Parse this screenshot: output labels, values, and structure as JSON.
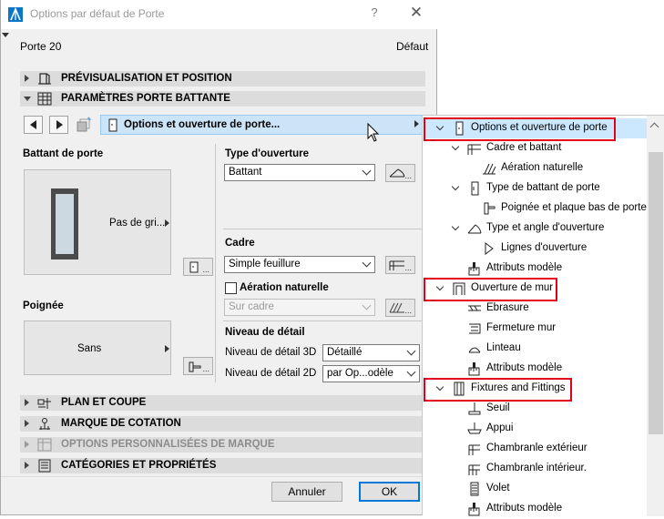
{
  "window": {
    "title": "Options par défaut de Porte",
    "help": "?",
    "close": "✕"
  },
  "header": {
    "door_name": "Porte 20",
    "default_label": "Défaut"
  },
  "sections_top": [
    {
      "label": "PRÉVISUALISATION ET POSITION",
      "expanded": false
    },
    {
      "label": "PARAMÈTRES PORTE BATTANTE",
      "expanded": true
    }
  ],
  "nav": {
    "page_label": "Options et ouverture de porte..."
  },
  "left_panel": {
    "leaf_title": "Battant de porte",
    "leaf_value": "Pas de gri...",
    "handle_title": "Poignée",
    "handle_value": "Sans"
  },
  "right_panel": {
    "opening_title": "Type d'ouverture",
    "opening_value": "Battant",
    "frame_title": "Cadre",
    "frame_value": "Simple feuillure",
    "ventilation_label": "Aération naturelle",
    "ventilation_checked": false,
    "ventilation_value": "Sur cadre",
    "detail_title": "Niveau de détail",
    "detail_3d_label": "Niveau de détail 3D",
    "detail_3d_value": "Détaillé",
    "detail_2d_label": "Niveau de détail 2D",
    "detail_2d_value": "par Op...odèle",
    "more": "..."
  },
  "sections_bottom": [
    {
      "label": "PLAN ET COUPE",
      "disabled": false
    },
    {
      "label": "MARQUE DE COTATION",
      "disabled": false
    },
    {
      "label": "OPTIONS PERSONNALISÉES DE MARQUE",
      "disabled": true
    },
    {
      "label": "CATÉGORIES ET PROPRIÉTÉS",
      "disabled": false
    }
  ],
  "footer": {
    "cancel": "Annuler",
    "ok": "OK"
  },
  "tree": [
    {
      "label": "Options et ouverture de porte",
      "level": 0,
      "expander": true,
      "selected": true,
      "highlight": true
    },
    {
      "label": "Cadre et battant",
      "level": 1,
      "expander": true
    },
    {
      "label": "Aération naturelle",
      "level": 2,
      "expander": false
    },
    {
      "label": "Type de battant de porte",
      "level": 1,
      "expander": true
    },
    {
      "label": "Poignée et plaque bas de porte",
      "level": 2,
      "expander": false
    },
    {
      "label": "Type et angle d'ouverture",
      "level": 1,
      "expander": true
    },
    {
      "label": "Lignes d'ouverture",
      "level": 2,
      "expander": false
    },
    {
      "label": "Attributs modèle",
      "level": 1,
      "expander": false
    },
    {
      "label": "Ouverture de mur",
      "level": 0,
      "expander": true,
      "highlight": true
    },
    {
      "label": "Ebrasure",
      "level": 1,
      "expander": false
    },
    {
      "label": "Fermeture mur",
      "level": 1,
      "expander": false
    },
    {
      "label": "Linteau",
      "level": 1,
      "expander": false
    },
    {
      "label": "Attributs modèle",
      "level": 1,
      "expander": false
    },
    {
      "label": "Fixtures and Fittings",
      "level": 0,
      "expander": true,
      "highlight": true
    },
    {
      "label": "Seuil",
      "level": 1,
      "expander": false
    },
    {
      "label": "Appui",
      "level": 1,
      "expander": false
    },
    {
      "label": "Chambranle extérieur",
      "level": 1,
      "expander": false
    },
    {
      "label": "Chambranle intérieur.",
      "level": 1,
      "expander": false
    },
    {
      "label": "Volet",
      "level": 1,
      "expander": false
    },
    {
      "label": "Attributs modèle",
      "level": 1,
      "expander": false
    }
  ],
  "colors": {
    "accent_selection": "#cce8ff",
    "highlight_box": "#e3001b",
    "primary_button_border": "#0078d7"
  }
}
